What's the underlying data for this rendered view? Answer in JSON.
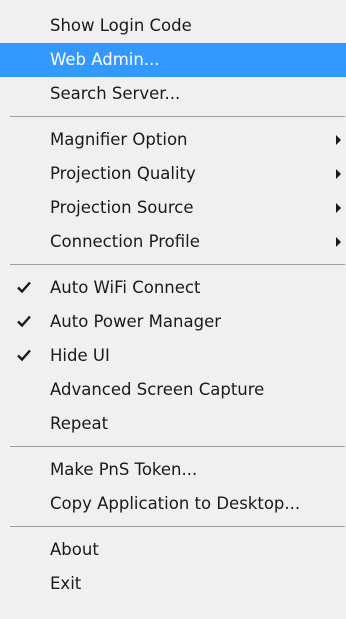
{
  "menu": {
    "groups": [
      {
        "items": [
          {
            "label": "Show Login Code",
            "name": "menu-item-show-login-code"
          },
          {
            "label": "Web Admin...",
            "name": "menu-item-web-admin",
            "selected": true
          },
          {
            "label": "Search Server...",
            "name": "menu-item-search-server"
          }
        ]
      },
      {
        "items": [
          {
            "label": "Magnifier Option",
            "name": "menu-item-magnifier-option",
            "submenu": true
          },
          {
            "label": "Projection Quality",
            "name": "menu-item-projection-quality",
            "submenu": true
          },
          {
            "label": "Projection Source",
            "name": "menu-item-projection-source",
            "submenu": true
          },
          {
            "label": "Connection Profile",
            "name": "menu-item-connection-profile",
            "submenu": true
          }
        ]
      },
      {
        "items": [
          {
            "label": "Auto WiFi Connect",
            "name": "menu-item-auto-wifi-connect",
            "checked": true
          },
          {
            "label": "Auto Power Manager",
            "name": "menu-item-auto-power-manager",
            "checked": true
          },
          {
            "label": "Hide UI",
            "name": "menu-item-hide-ui",
            "checked": true
          },
          {
            "label": "Advanced Screen Capture",
            "name": "menu-item-advanced-screen-capture"
          },
          {
            "label": "Repeat",
            "name": "menu-item-repeat"
          }
        ]
      },
      {
        "items": [
          {
            "label": "Make PnS Token...",
            "name": "menu-item-make-pns-token"
          },
          {
            "label": "Copy Application to Desktop...",
            "name": "menu-item-copy-application-to-desktop"
          }
        ]
      },
      {
        "items": [
          {
            "label": "About",
            "name": "menu-item-about"
          },
          {
            "label": "Exit",
            "name": "menu-item-exit"
          }
        ]
      }
    ],
    "colors": {
      "background": "#f0f0f0",
      "highlight": "#3399ff",
      "text": "#1a1a1a",
      "separator": "#a0a0a0"
    },
    "icons": {
      "check": "checkmark-icon",
      "submenu": "submenu-arrow-icon"
    }
  }
}
